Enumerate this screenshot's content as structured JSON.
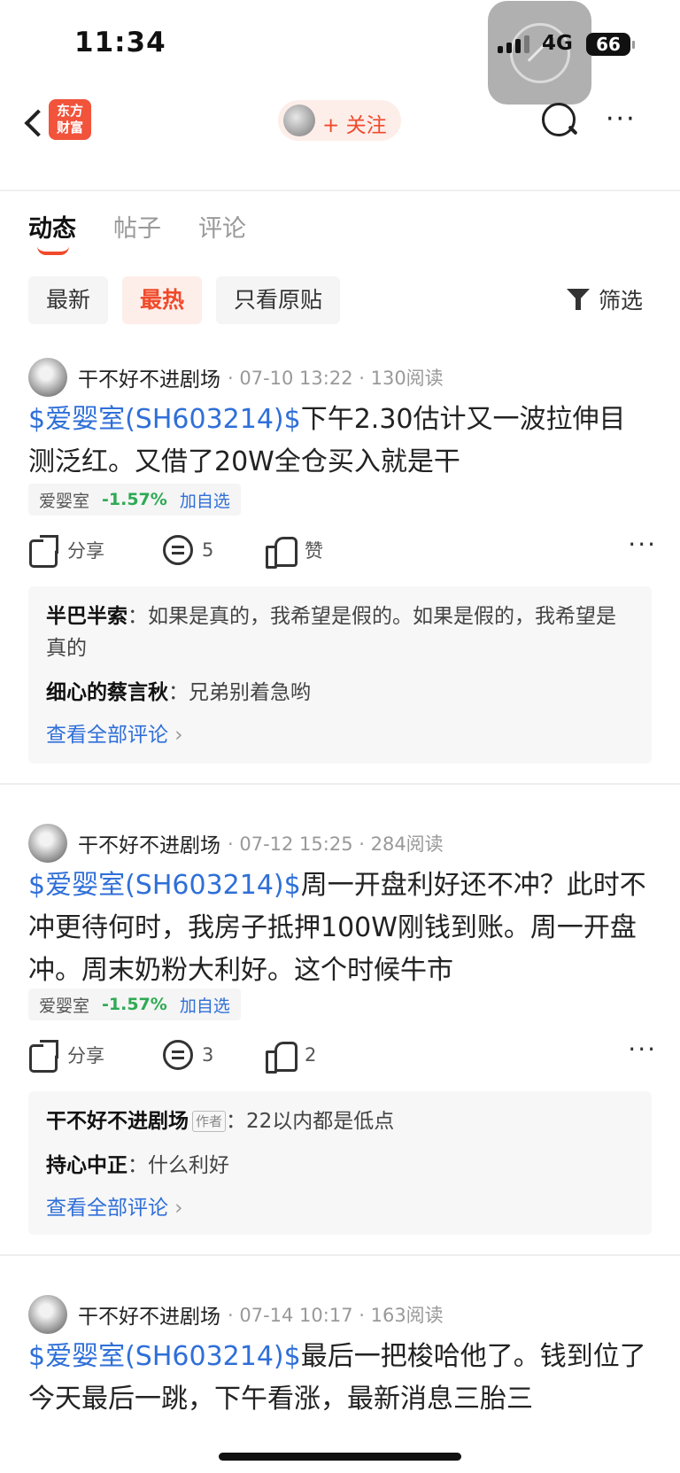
{
  "status": {
    "time": "11:34",
    "network": "4G",
    "battery": "66"
  },
  "nav": {
    "logo_line1": "东方",
    "logo_line2": "财富",
    "follow_label": "+ 关注"
  },
  "tabs": [
    {
      "label": "动态",
      "active": true
    },
    {
      "label": "帖子",
      "active": false
    },
    {
      "label": "评论",
      "active": false
    }
  ],
  "filters": [
    {
      "label": "最新",
      "active": false
    },
    {
      "label": "最热",
      "active": true
    },
    {
      "label": "只看原贴",
      "active": false
    }
  ],
  "filter_button": "筛选",
  "posts": [
    {
      "author": "干不好不进剧场",
      "meta": "· 07-10 13:22 · 130阅读",
      "stock_link": "$爱婴室(SH603214)$",
      "text": "下午2.30估计又一波拉伸目测泛红。又借了20W全仓买入就是干",
      "tag": {
        "name": "爱婴室",
        "change": "-1.57%",
        "add": "加自选"
      },
      "share": "分享",
      "comments_count": "5",
      "likes": "赞",
      "comments": [
        {
          "user": "半巴半索",
          "author_badge": "",
          "text": "如果是真的，我希望是假的。如果是假的，我希望是真的"
        },
        {
          "user": "细心的蔡言秋",
          "author_badge": "",
          "text": "兄弟别着急哟"
        }
      ],
      "see_all": "查看全部评论"
    },
    {
      "author": "干不好不进剧场",
      "meta": "· 07-12 15:25 · 284阅读",
      "stock_link": "$爱婴室(SH603214)$",
      "text": "周一开盘利好还不冲？此时不冲更待何时，我房子抵押100W刚钱到账。周一开盘冲。周末奶粉大利好。这个时候牛市",
      "tag": {
        "name": "爱婴室",
        "change": "-1.57%",
        "add": "加自选"
      },
      "share": "分享",
      "comments_count": "3",
      "likes": "2",
      "comments": [
        {
          "user": "干不好不进剧场",
          "author_badge": "作者",
          "text": "22以内都是低点"
        },
        {
          "user": "持心中正",
          "author_badge": "",
          "text": "什么利好"
        }
      ],
      "see_all": "查看全部评论"
    },
    {
      "author": "干不好不进剧场",
      "meta": "· 07-14 10:17 · 163阅读",
      "stock_link": "$爱婴室(SH603214)$",
      "text": "最后一把梭哈他了。钱到位了今天最后一跳，下午看涨，最新消息三胎三"
    }
  ]
}
